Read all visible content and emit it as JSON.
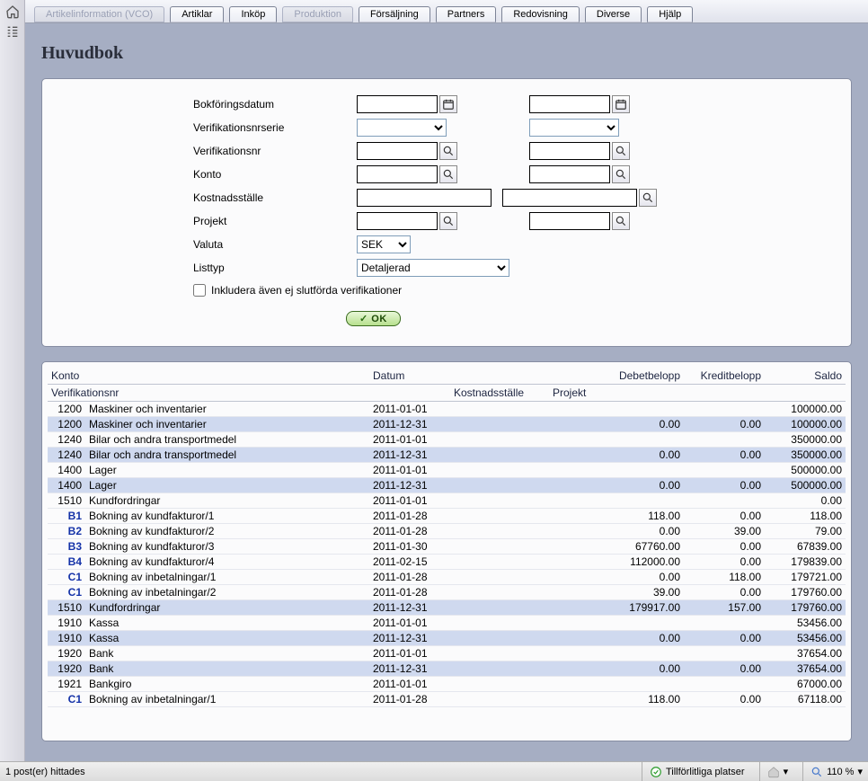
{
  "menu": {
    "tabs": [
      {
        "label": "Artikelinformation (VCO)",
        "disabled": true
      },
      {
        "label": "Artiklar",
        "disabled": false
      },
      {
        "label": "Inköp",
        "disabled": false
      },
      {
        "label": "Produktion",
        "disabled": true
      },
      {
        "label": "Försäljning",
        "disabled": false
      },
      {
        "label": "Partners",
        "disabled": false
      },
      {
        "label": "Redovisning",
        "disabled": false
      },
      {
        "label": "Diverse",
        "disabled": false
      },
      {
        "label": "Hjälp",
        "disabled": false
      }
    ]
  },
  "page": {
    "title": "Huvudbok"
  },
  "filters": {
    "labels": {
      "bokforingsdatum": "Bokföringsdatum",
      "verifikationsnrserie": "Verifikationsnrserie",
      "verifikationsnr": "Verifikationsnr",
      "konto": "Konto",
      "kostnadsstalle": "Kostnadsställe",
      "projekt": "Projekt",
      "valuta": "Valuta",
      "listtyp": "Listtyp"
    },
    "valuta_value": "SEK",
    "listtyp_value": "Detaljerad",
    "include_checkbox_label": "Inkludera även ej slutförda verifikationer",
    "ok_label": "OK"
  },
  "results": {
    "headers": {
      "r1": {
        "konto": "Konto",
        "datum": "Datum",
        "debet": "Debetbelopp",
        "kredit": "Kreditbelopp",
        "saldo": "Saldo"
      },
      "r2": {
        "verifikationsnr": "Verifikationsnr",
        "kostnadsstalle": "Kostnadsställe",
        "projekt": "Projekt"
      }
    },
    "rows": [
      {
        "sub": false,
        "id": "1200",
        "desc": "Maskiner och inventarier",
        "date": "2011-01-01",
        "debet": "",
        "kredit": "",
        "saldo": "100000.00"
      },
      {
        "sub": true,
        "id": "1200",
        "desc": "Maskiner och inventarier",
        "date": "2011-12-31",
        "debet": "0.00",
        "kredit": "0.00",
        "saldo": "100000.00"
      },
      {
        "sub": false,
        "id": "1240",
        "desc": "Bilar och andra transportmedel",
        "date": "2011-01-01",
        "debet": "",
        "kredit": "",
        "saldo": "350000.00"
      },
      {
        "sub": true,
        "id": "1240",
        "desc": "Bilar och andra transportmedel",
        "date": "2011-12-31",
        "debet": "0.00",
        "kredit": "0.00",
        "saldo": "350000.00"
      },
      {
        "sub": false,
        "id": "1400",
        "desc": "Lager",
        "date": "2011-01-01",
        "debet": "",
        "kredit": "",
        "saldo": "500000.00"
      },
      {
        "sub": true,
        "id": "1400",
        "desc": "Lager",
        "date": "2011-12-31",
        "debet": "0.00",
        "kredit": "0.00",
        "saldo": "500000.00"
      },
      {
        "sub": false,
        "id": "1510",
        "desc": "Kundfordringar",
        "date": "2011-01-01",
        "debet": "",
        "kredit": "",
        "saldo": "0.00"
      },
      {
        "sub": false,
        "link": true,
        "id": "B1",
        "desc": "Bokning av kundfakturor/1",
        "date": "2011-01-28",
        "debet": "118.00",
        "kredit": "0.00",
        "saldo": "118.00"
      },
      {
        "sub": false,
        "link": true,
        "id": "B2",
        "desc": "Bokning av kundfakturor/2",
        "date": "2011-01-28",
        "debet": "0.00",
        "kredit": "39.00",
        "saldo": "79.00"
      },
      {
        "sub": false,
        "link": true,
        "id": "B3",
        "desc": "Bokning av kundfakturor/3",
        "date": "2011-01-30",
        "debet": "67760.00",
        "kredit": "0.00",
        "saldo": "67839.00"
      },
      {
        "sub": false,
        "link": true,
        "id": "B4",
        "desc": "Bokning av kundfakturor/4",
        "date": "2011-02-15",
        "debet": "112000.00",
        "kredit": "0.00",
        "saldo": "179839.00"
      },
      {
        "sub": false,
        "link": true,
        "id": "C1",
        "desc": "Bokning av inbetalningar/1",
        "date": "2011-01-28",
        "debet": "0.00",
        "kredit": "118.00",
        "saldo": "179721.00"
      },
      {
        "sub": false,
        "link": true,
        "id": "C1",
        "desc": "Bokning av inbetalningar/2",
        "date": "2011-01-28",
        "debet": "39.00",
        "kredit": "0.00",
        "saldo": "179760.00"
      },
      {
        "sub": true,
        "id": "1510",
        "desc": "Kundfordringar",
        "date": "2011-12-31",
        "debet": "179917.00",
        "kredit": "157.00",
        "saldo": "179760.00"
      },
      {
        "sub": false,
        "id": "1910",
        "desc": "Kassa",
        "date": "2011-01-01",
        "debet": "",
        "kredit": "",
        "saldo": "53456.00"
      },
      {
        "sub": true,
        "id": "1910",
        "desc": "Kassa",
        "date": "2011-12-31",
        "debet": "0.00",
        "kredit": "0.00",
        "saldo": "53456.00"
      },
      {
        "sub": false,
        "id": "1920",
        "desc": "Bank",
        "date": "2011-01-01",
        "debet": "",
        "kredit": "",
        "saldo": "37654.00"
      },
      {
        "sub": true,
        "id": "1920",
        "desc": "Bank",
        "date": "2011-12-31",
        "debet": "0.00",
        "kredit": "0.00",
        "saldo": "37654.00"
      },
      {
        "sub": false,
        "id": "1921",
        "desc": "Bankgiro",
        "date": "2011-01-01",
        "debet": "",
        "kredit": "",
        "saldo": "67000.00"
      },
      {
        "sub": false,
        "link": true,
        "id": "C1",
        "desc": "Bokning av inbetalningar/1",
        "date": "2011-01-28",
        "debet": "118.00",
        "kredit": "0.00",
        "saldo": "67118.00"
      }
    ]
  },
  "statusbar": {
    "posts_found": "1 post(er) hittades",
    "trusted_sites": "Tillförlitliga platser",
    "zoom": "110 %"
  }
}
